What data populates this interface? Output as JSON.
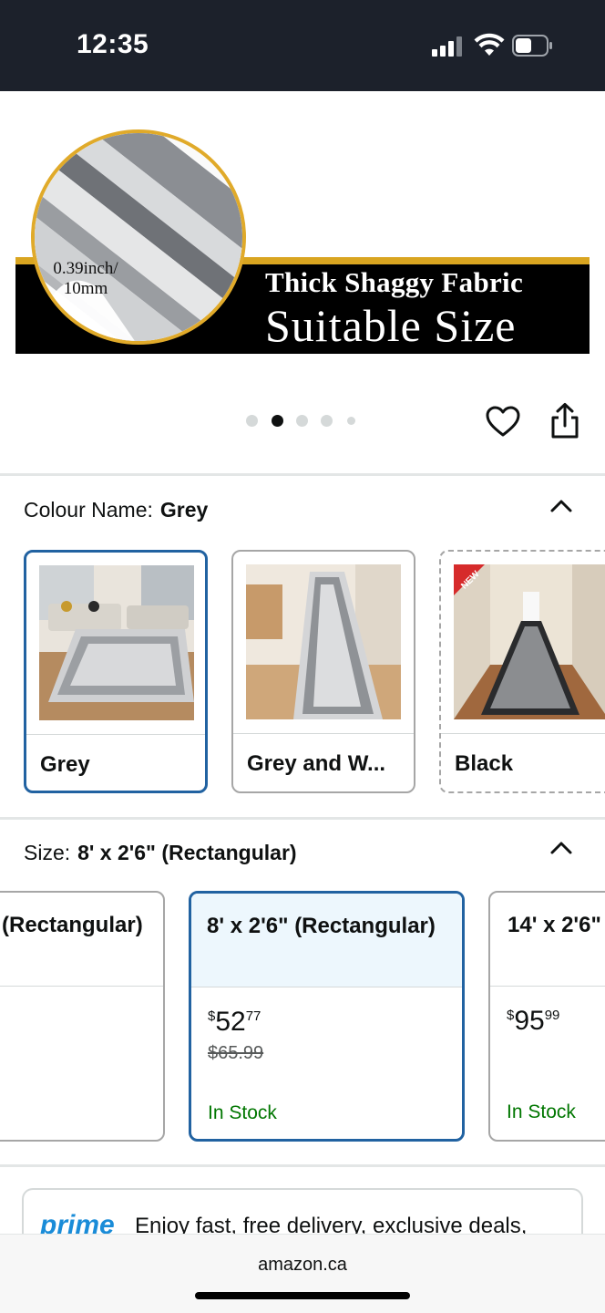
{
  "status_bar": {
    "time": "12:35"
  },
  "hero": {
    "thickness_label_1": "0.39inch/",
    "thickness_label_2": "10mm",
    "line_1": "Thick Shaggy Fabric",
    "line_2": "Suitable Size",
    "accent_color": "#d9a520",
    "carousel": {
      "total_dots": 5,
      "active_index": 1
    }
  },
  "actions": {
    "favorite_icon": "heart-icon",
    "share_icon": "share-icon"
  },
  "colour": {
    "label": "Colour Name:",
    "selected": "Grey",
    "options": [
      {
        "name": "Grey",
        "selected": true,
        "available": true
      },
      {
        "name": "Grey and W...",
        "selected": false,
        "available": true
      },
      {
        "name": "Black",
        "selected": false,
        "available": false,
        "badge": "NEW"
      }
    ]
  },
  "size": {
    "label": "Size:",
    "selected": "8' x 2'6\" (Rectangular)",
    "options": [
      {
        "title": "(Rectangular)",
        "price_whole": "",
        "price_cents": "",
        "was": "",
        "stock": ""
      },
      {
        "title": "8' x 2'6\" (Rectangular)",
        "price_whole": "52",
        "price_cents": "77",
        "currency": "$",
        "was": "$65.99",
        "stock": "In Stock",
        "selected": true
      },
      {
        "title": "14' x 2'6\"",
        "price_whole": "95",
        "price_cents": "99",
        "currency": "$",
        "was": "",
        "stock": "In Stock"
      }
    ]
  },
  "prime": {
    "logo": "prime",
    "text": "Enjoy fast, free delivery, exclusive deals,"
  },
  "browser": {
    "url": "amazon.ca"
  },
  "colors": {
    "selected_border": "#2162a1",
    "in_stock": "#007600",
    "prime_blue": "#1a8cd8",
    "status_bar_bg": "#1c212b"
  }
}
